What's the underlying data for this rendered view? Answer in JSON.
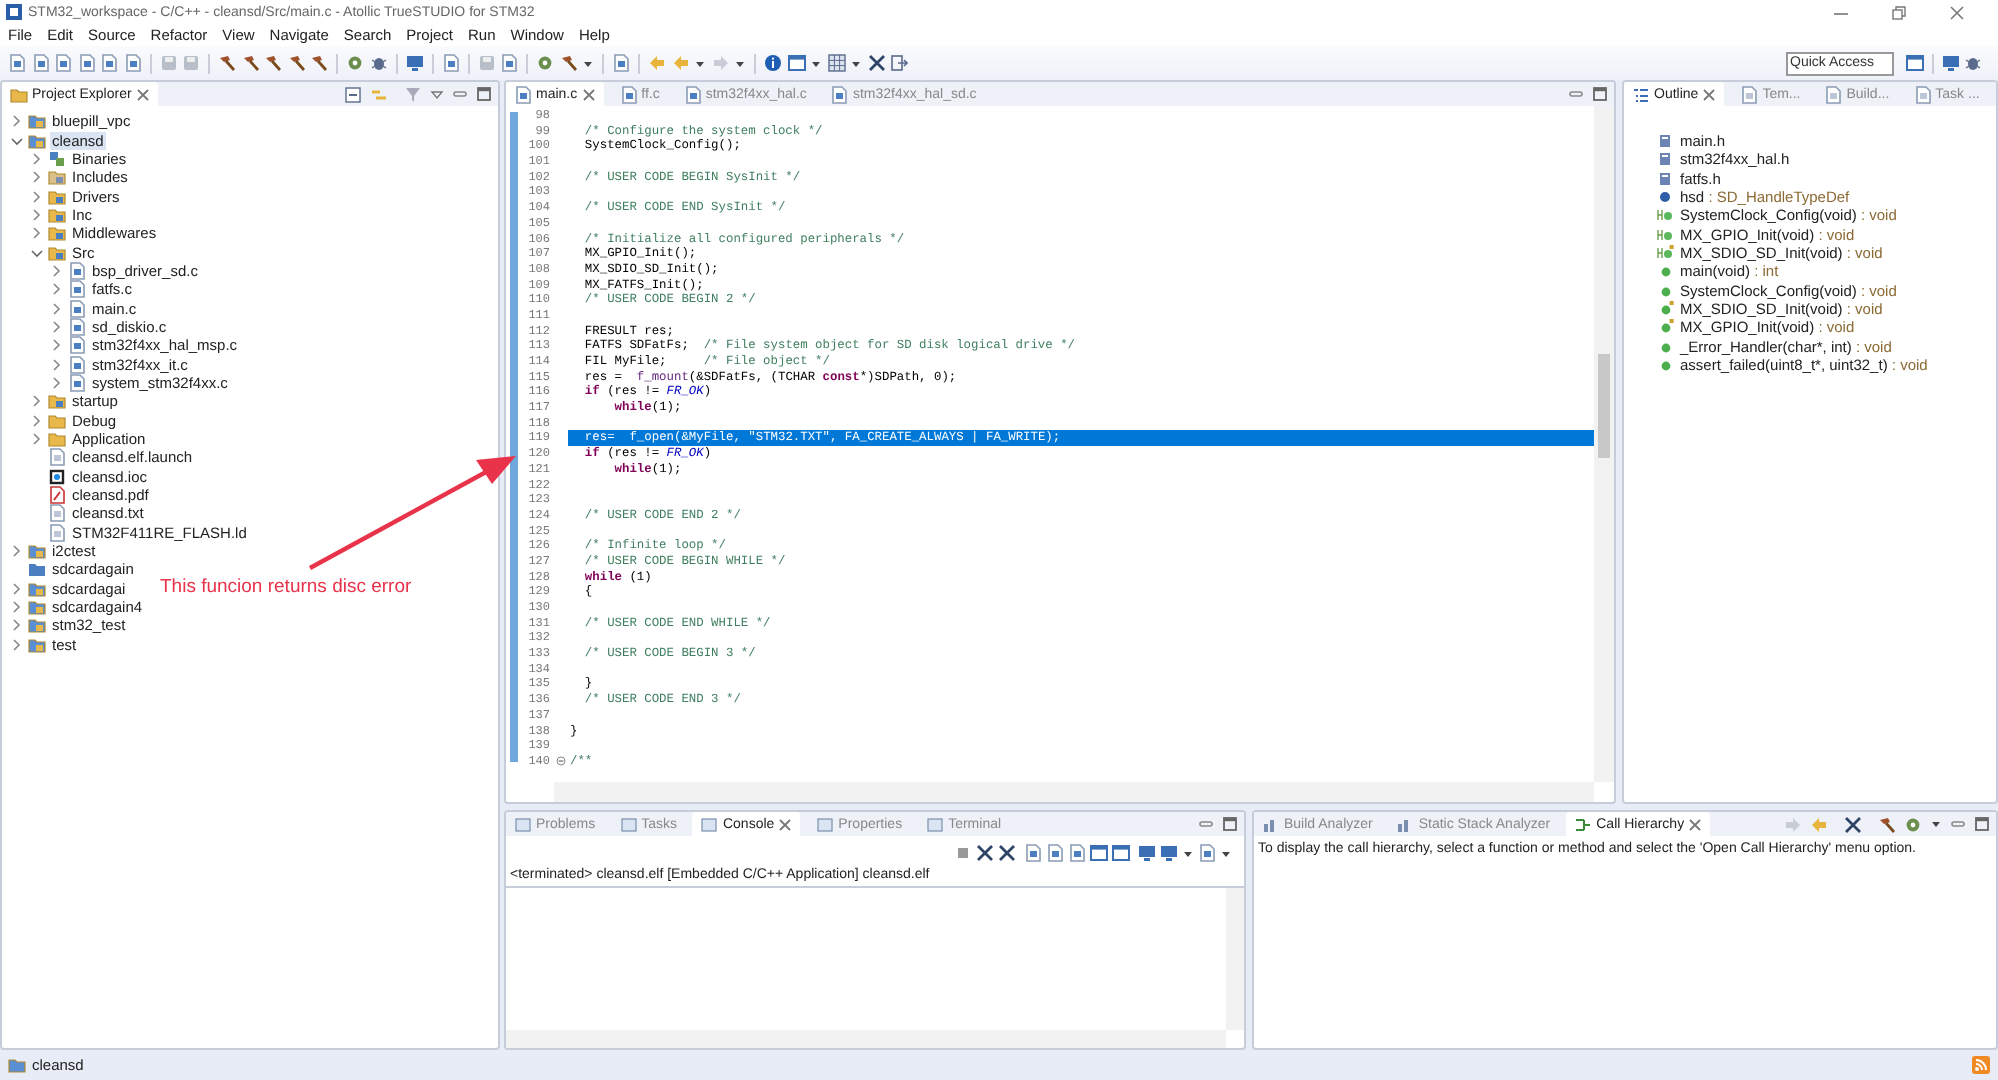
{
  "window": {
    "title": "STM32_workspace - C/C++ - cleansd/Src/main.c - Atollic TrueSTUDIO for STM32"
  },
  "menu": [
    "File",
    "Edit",
    "Source",
    "Refactor",
    "View",
    "Navigate",
    "Search",
    "Project",
    "Run",
    "Window",
    "Help"
  ],
  "quick_access": {
    "placeholder": "Quick Access"
  },
  "project_explorer": {
    "title": "Project Explorer",
    "items": [
      {
        "label": "bluepill_vpc",
        "kind": "project",
        "expanded": false,
        "selected": false
      },
      {
        "label": "cleansd",
        "kind": "project",
        "expanded": true,
        "selected": true,
        "children": [
          {
            "label": "Binaries",
            "kind": "binaries",
            "expanded": false,
            "selected": false
          },
          {
            "label": "Includes",
            "kind": "includes",
            "expanded": false,
            "selected": false
          },
          {
            "label": "Drivers",
            "kind": "source-folder",
            "expanded": false,
            "selected": false
          },
          {
            "label": "Inc",
            "kind": "source-folder",
            "expanded": false,
            "selected": false
          },
          {
            "label": "Middlewares",
            "kind": "source-folder",
            "expanded": false,
            "selected": false
          },
          {
            "label": "Src",
            "kind": "source-folder",
            "expanded": true,
            "selected": false,
            "children": [
              {
                "label": "bsp_driver_sd.c",
                "kind": "c-file",
                "expanded": false,
                "selected": false
              },
              {
                "label": "fatfs.c",
                "kind": "c-file",
                "expanded": false,
                "selected": false
              },
              {
                "label": "main.c",
                "kind": "c-file",
                "expanded": false,
                "selected": false
              },
              {
                "label": "sd_diskio.c",
                "kind": "c-file",
                "expanded": false,
                "selected": false
              },
              {
                "label": "stm32f4xx_hal_msp.c",
                "kind": "c-file",
                "expanded": false,
                "selected": false
              },
              {
                "label": "stm32f4xx_it.c",
                "kind": "c-file",
                "expanded": false,
                "selected": false
              },
              {
                "label": "system_stm32f4xx.c",
                "kind": "c-file",
                "expanded": false,
                "selected": false
              }
            ]
          },
          {
            "label": "startup",
            "kind": "source-folder",
            "expanded": false,
            "selected": false
          },
          {
            "label": "Debug",
            "kind": "folder",
            "expanded": false,
            "selected": false
          },
          {
            "label": "Application",
            "kind": "folder",
            "expanded": false,
            "selected": false
          },
          {
            "label": "cleansd.elf.launch",
            "kind": "file",
            "selected": false
          },
          {
            "label": "cleansd.ioc",
            "kind": "ioc",
            "selected": false
          },
          {
            "label": "cleansd.pdf",
            "kind": "pdf",
            "selected": false
          },
          {
            "label": "cleansd.txt",
            "kind": "file",
            "selected": false
          },
          {
            "label": "STM32F411RE_FLASH.ld",
            "kind": "file",
            "selected": false
          }
        ]
      },
      {
        "label": "i2ctest",
        "kind": "project",
        "expanded": false,
        "selected": false
      },
      {
        "label": "sdcardagain",
        "kind": "closed-project",
        "selected": false
      },
      {
        "label": "sdcardagai",
        "kind": "project",
        "expanded": false,
        "selected": false
      },
      {
        "label": "sdcardagain4",
        "kind": "project",
        "expanded": false,
        "selected": false
      },
      {
        "label": "stm32_test",
        "kind": "project",
        "expanded": false,
        "selected": false
      },
      {
        "label": "test",
        "kind": "project",
        "expanded": false,
        "selected": false
      }
    ]
  },
  "editor": {
    "tabs": [
      {
        "label": "main.c",
        "selected": true
      },
      {
        "label": "ff.c",
        "selected": false
      },
      {
        "label": "stm32f4xx_hal.c",
        "selected": false
      },
      {
        "label": "stm32f4xx_hal_sd.c",
        "selected": false
      }
    ],
    "lines": [
      {
        "num": "98",
        "selected": false
      },
      {
        "num": "99",
        "selected": false,
        "parts": [
          {
            "text": "  /* Configure the system clock */",
            "kind": "comment"
          }
        ]
      },
      {
        "num": "100",
        "selected": false,
        "parts": [
          {
            "text": "  SystemClock_Config();",
            "kind": "plain"
          }
        ]
      },
      {
        "num": "101",
        "selected": false
      },
      {
        "num": "102",
        "selected": false,
        "parts": [
          {
            "text": "  /* USER CODE BEGIN SysInit */",
            "kind": "comment"
          }
        ]
      },
      {
        "num": "103",
        "selected": false
      },
      {
        "num": "104",
        "selected": false,
        "parts": [
          {
            "text": "  /* USER CODE END SysInit */",
            "kind": "comment"
          }
        ]
      },
      {
        "num": "105",
        "selected": false
      },
      {
        "num": "106",
        "selected": false,
        "parts": [
          {
            "text": "  /* Initialize all configured peripherals */",
            "kind": "comment"
          }
        ]
      },
      {
        "num": "107",
        "selected": false,
        "parts": [
          {
            "text": "  MX_GPIO_Init();",
            "kind": "plain"
          }
        ]
      },
      {
        "num": "108",
        "selected": false,
        "parts": [
          {
            "text": "  MX_SDIO_SD_Init();",
            "kind": "plain"
          }
        ]
      },
      {
        "num": "109",
        "selected": false,
        "parts": [
          {
            "text": "  MX_FATFS_Init();",
            "kind": "plain"
          }
        ]
      },
      {
        "num": "110",
        "selected": false,
        "parts": [
          {
            "text": "  /* USER CODE BEGIN 2 */",
            "kind": "comment"
          }
        ]
      },
      {
        "num": "111",
        "selected": false
      },
      {
        "num": "112",
        "selected": false,
        "parts": [
          {
            "text": "  FRESULT res;",
            "kind": "plain"
          }
        ]
      },
      {
        "num": "113",
        "selected": false,
        "parts": [
          {
            "text": "  FATFS SDFatFs;  ",
            "kind": "plain"
          },
          {
            "text": "/* File system object for SD disk logical drive */",
            "kind": "comment"
          }
        ]
      },
      {
        "num": "114",
        "selected": false,
        "parts": [
          {
            "text": "  FIL MyFile;     ",
            "kind": "plain"
          },
          {
            "text": "/* File object */",
            "kind": "comment"
          }
        ]
      },
      {
        "num": "115",
        "selected": false,
        "parts": [
          {
            "text": "  res =  ",
            "kind": "plain"
          },
          {
            "text": "f_mount",
            "kind": "function"
          },
          {
            "text": "(&SDFatFs, (TCHAR ",
            "kind": "plain"
          },
          {
            "text": "const",
            "kind": "keyword"
          },
          {
            "text": "*)SDPath, 0);",
            "kind": "plain"
          }
        ]
      },
      {
        "num": "116",
        "selected": false,
        "parts": [
          {
            "text": "  if",
            "kind": "keyword"
          },
          {
            "text": " (res != ",
            "kind": "plain"
          },
          {
            "text": "FR_OK",
            "kind": "constant"
          },
          {
            "text": ")",
            "kind": "plain"
          }
        ]
      },
      {
        "num": "117",
        "selected": false,
        "parts": [
          {
            "text": "      while",
            "kind": "keyword"
          },
          {
            "text": "(1);",
            "kind": "plain"
          }
        ]
      },
      {
        "num": "118",
        "selected": false
      },
      {
        "num": "119",
        "selected": true,
        "parts": [
          {
            "text": "  res=  ",
            "kind": "plain"
          },
          {
            "text": "f_open",
            "kind": "function"
          },
          {
            "text": "(&MyFile, ",
            "kind": "plain"
          },
          {
            "text": "\"STM32.TXT\"",
            "kind": "string"
          },
          {
            "text": ", FA_CREATE_ALWAYS | FA_WRITE);",
            "kind": "plain"
          }
        ]
      },
      {
        "num": "120",
        "selected": false,
        "parts": [
          {
            "text": "  if",
            "kind": "keyword"
          },
          {
            "text": " (res != ",
            "kind": "plain"
          },
          {
            "text": "FR_OK",
            "kind": "constant"
          },
          {
            "text": ")",
            "kind": "plain"
          }
        ]
      },
      {
        "num": "121",
        "selected": false,
        "parts": [
          {
            "text": "      while",
            "kind": "keyword"
          },
          {
            "text": "(1);",
            "kind": "plain"
          }
        ]
      },
      {
        "num": "122",
        "selected": false
      },
      {
        "num": "123",
        "selected": false
      },
      {
        "num": "124",
        "selected": false,
        "parts": [
          {
            "text": "  /* USER CODE END 2 */",
            "kind": "comment"
          }
        ]
      },
      {
        "num": "125",
        "selected": false
      },
      {
        "num": "126",
        "selected": false,
        "parts": [
          {
            "text": "  /* Infinite loop */",
            "kind": "comment"
          }
        ]
      },
      {
        "num": "127",
        "selected": false,
        "parts": [
          {
            "text": "  /* USER CODE BEGIN WHILE */",
            "kind": "comment"
          }
        ]
      },
      {
        "num": "128",
        "selected": false,
        "parts": [
          {
            "text": "  while",
            "kind": "keyword"
          },
          {
            "text": " (1)",
            "kind": "plain"
          }
        ]
      },
      {
        "num": "129",
        "selected": false,
        "parts": [
          {
            "text": "  {",
            "kind": "plain"
          }
        ]
      },
      {
        "num": "130",
        "selected": false
      },
      {
        "num": "131",
        "selected": false,
        "parts": [
          {
            "text": "  /* USER CODE END WHILE */",
            "kind": "comment"
          }
        ]
      },
      {
        "num": "132",
        "selected": false
      },
      {
        "num": "133",
        "selected": false,
        "parts": [
          {
            "text": "  /* USER CODE BEGIN 3 */",
            "kind": "comment"
          }
        ]
      },
      {
        "num": "134",
        "selected": false
      },
      {
        "num": "135",
        "selected": false,
        "parts": [
          {
            "text": "  }",
            "kind": "plain"
          }
        ]
      },
      {
        "num": "136",
        "selected": false,
        "parts": [
          {
            "text": "  /* USER CODE END 3 */",
            "kind": "comment"
          }
        ]
      },
      {
        "num": "137",
        "selected": false
      },
      {
        "num": "138",
        "selected": false,
        "parts": [
          {
            "text": "}",
            "kind": "plain"
          }
        ]
      },
      {
        "num": "139",
        "selected": false
      },
      {
        "num": "140",
        "selected": false,
        "collapsible": true,
        "parts": [
          {
            "text": "/**",
            "kind": "comment"
          }
        ]
      }
    ]
  },
  "outline": {
    "tabs": [
      {
        "label": "Outline",
        "selected": true
      },
      {
        "label": "Tem...",
        "selected": false
      },
      {
        "label": "Build...",
        "selected": false
      },
      {
        "label": "Task ...",
        "selected": false
      }
    ],
    "items": [
      {
        "name": "main.h",
        "kind": "include"
      },
      {
        "name": "stm32f4xx_hal.h",
        "kind": "include"
      },
      {
        "name": "fatfs.h",
        "kind": "include"
      },
      {
        "name": "hsd",
        "type": ": SD_HandleTypeDef",
        "kind": "variable"
      },
      {
        "name": "SystemClock_Config(void)",
        "type": ": void",
        "kind": "prototype"
      },
      {
        "name": "MX_GPIO_Init(void)",
        "type": ": void",
        "kind": "prototype"
      },
      {
        "name": "MX_SDIO_SD_Init(void)",
        "type": ": void",
        "kind": "static-prototype"
      },
      {
        "name": "main(void)",
        "type": ": int",
        "kind": "function"
      },
      {
        "name": "SystemClock_Config(void)",
        "type": ": void",
        "kind": "function"
      },
      {
        "name": "MX_SDIO_SD_Init(void)",
        "type": ": void",
        "kind": "static-function"
      },
      {
        "name": "MX_GPIO_Init(void)",
        "type": ": void",
        "kind": "static-function"
      },
      {
        "name": "_Error_Handler(char*, int)",
        "type": ": void",
        "kind": "function"
      },
      {
        "name": "assert_failed(uint8_t*, uint32_t)",
        "type": ": void",
        "kind": "function"
      }
    ]
  },
  "console": {
    "tabs": [
      {
        "label": "Problems",
        "selected": false
      },
      {
        "label": "Tasks",
        "selected": false
      },
      {
        "label": "Console",
        "selected": true
      },
      {
        "label": "Properties",
        "selected": false
      },
      {
        "label": "Terminal",
        "selected": false
      }
    ],
    "header": "<terminated> cleansd.elf [Embedded C/C++ Application] cleansd.elf"
  },
  "call_hierarchy": {
    "tabs": [
      {
        "label": "Build Analyzer",
        "selected": false
      },
      {
        "label": "Static Stack Analyzer",
        "selected": false
      },
      {
        "label": "Call Hierarchy",
        "selected": true
      }
    ],
    "message": "To display the call hierarchy, select a function or method and select the 'Open Call Hierarchy' menu option."
  },
  "status_bar": {
    "text": "cleansd"
  },
  "annotation": {
    "text": "This funcion returns disc error"
  }
}
